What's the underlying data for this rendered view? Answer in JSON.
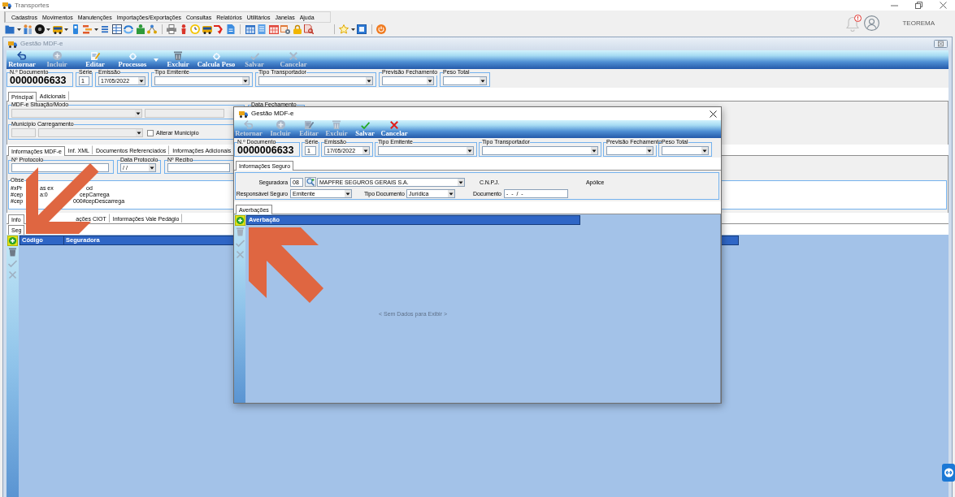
{
  "app_window": {
    "title": "Transportes",
    "user_name": "TEOREMA"
  },
  "menu": [
    "Cadastros",
    "Movimentos",
    "Manutenções",
    "Importações/Exportações",
    "Consultas",
    "Relatórios",
    "Utilitários",
    "Janelas",
    "Ajuda"
  ],
  "main_window": {
    "title": "Gestão MDF-e",
    "toolbar": [
      {
        "label": "Retornar",
        "disabled": false,
        "dropdown": false
      },
      {
        "label": "Incluir",
        "disabled": true,
        "dropdown": false
      },
      {
        "label": "Editar",
        "disabled": false,
        "dropdown": false
      },
      {
        "label": "Processos",
        "disabled": false,
        "dropdown": true
      },
      {
        "label": "Excluir",
        "disabled": false,
        "dropdown": false
      },
      {
        "label": "Calcula Peso",
        "disabled": false,
        "dropdown": false
      },
      {
        "label": "Salvar",
        "disabled": true,
        "dropdown": false
      },
      {
        "label": "Cancelar",
        "disabled": true,
        "dropdown": false
      }
    ],
    "header_fields": [
      {
        "label": "N.º Documento",
        "kind": "display",
        "value": "0000006633"
      },
      {
        "label": "Série",
        "kind": "text",
        "value": "1"
      },
      {
        "label": "Emissão",
        "kind": "select",
        "value": "17/05/2022"
      },
      {
        "label": "Tipo Emitente",
        "kind": "select"
      },
      {
        "label": "Tipo Transportador",
        "kind": "select"
      },
      {
        "label": "Previsão Fechamento",
        "kind": "select"
      },
      {
        "label": "Peso Total",
        "kind": "select"
      }
    ],
    "tabs": [
      {
        "label": "Principal",
        "selected": true
      },
      {
        "label": "Adicionais",
        "selected": false
      }
    ],
    "situation_group": {
      "label": "MDF-e Situação/Modo",
      "fields": [
        {
          "kind": "select",
          "disabled": true
        },
        {
          "kind": "text",
          "disabled": true
        }
      ]
    },
    "closing_date_group": {
      "label": "Data Fechamento"
    },
    "loading_city_group": {
      "label": "Município Carregamento",
      "fields": [
        {
          "kind": "text",
          "disabled": true
        },
        {
          "kind": "select",
          "disabled": true
        }
      ],
      "checkbox": {
        "label": "Alterar Município",
        "checked": false
      }
    },
    "detail_tabs": [
      {
        "label": "Informações MDF-e",
        "selected": true
      },
      {
        "label": "Inf. XML",
        "selected": false
      },
      {
        "label": "Documentos Referenciados",
        "selected": false
      },
      {
        "label": "Informações Adicionais",
        "selected": false
      }
    ],
    "protocol_fields": [
      {
        "label": "Nº Protocolo",
        "kind": "text"
      },
      {
        "label": "Data Protocolo",
        "kind": "select",
        "value": "/ /"
      },
      {
        "label": "Nº Recibo",
        "kind": "text"
      }
    ],
    "observations": {
      "label": "Obse",
      "lines": [
        [
          "#xPr",
          "as ex",
          "od"
        ],
        [
          "#cep",
          "a:0",
          "cepCarrega"
        ],
        [
          "#cep",
          "000#cepDescarrega"
        ]
      ]
    },
    "lower_tabs": [
      {
        "label": "Info",
        "selected": true
      },
      {
        "label": "ações CIOT",
        "selected": false
      },
      {
        "label": "Informações Vale Pedágio",
        "selected": false
      }
    ],
    "insurer_tabs": [
      {
        "label": "Seg",
        "selected": true
      }
    ],
    "grid": {
      "columns": [
        "Código",
        "Seguradora"
      ],
      "side_tools": [
        {
          "highlighted": true,
          "disabled": false
        },
        {
          "highlighted": false,
          "disabled": false
        },
        {
          "highlighted": false,
          "disabled": true
        },
        {
          "highlighted": false,
          "disabled": true
        }
      ]
    }
  },
  "dialog": {
    "title": "Gestão MDF-e",
    "toolbar": [
      {
        "label": "Retornar",
        "disabled": true,
        "dropdown": false
      },
      {
        "label": "Incluir",
        "disabled": true,
        "dropdown": false
      },
      {
        "label": "Editar",
        "disabled": true,
        "dropdown": false
      },
      {
        "label": "Excluir",
        "disabled": true,
        "dropdown": false
      },
      {
        "label": "Salvar",
        "disabled": false,
        "dropdown": false
      },
      {
        "label": "Cancelar",
        "disabled": false,
        "dropdown": false
      }
    ],
    "header_fields": [
      {
        "label": "N.º Documento",
        "kind": "display",
        "value": "0000006633"
      },
      {
        "label": "Série",
        "kind": "text",
        "value": "1"
      },
      {
        "label": "Emissão",
        "kind": "select",
        "value": "17/05/2022"
      },
      {
        "label": "Tipo Emitente",
        "kind": "select"
      },
      {
        "label": "Tipo Transportador",
        "kind": "select"
      },
      {
        "label": "Previsão Fechamento",
        "kind": "select"
      },
      {
        "label": "Peso Total",
        "kind": "select"
      }
    ],
    "tabs": [
      {
        "label": "Informações Seguro",
        "selected": true
      }
    ],
    "insurance": {
      "insurer_label": "Seguradora",
      "insurer_code": "08",
      "insurer_name": "MAPFRE SEGUROS GERAIS S.A.",
      "cnpj_label": "C.N.P.J.",
      "policy_label": "Apólice",
      "responsible_label": "Responsável Seguro",
      "responsible_value": "Emitente",
      "document_type_label": "Tipo Documento",
      "document_type_value": "Jurídica",
      "document_label": "Documento",
      "document_value": "-  -  /  -"
    },
    "endorsement_tabs": [
      {
        "label": "Averbações",
        "selected": true
      }
    ],
    "grid": {
      "columns": [
        "Averbação"
      ],
      "empty_text": "< Sem Dados para Exibir >",
      "side_tools": [
        {
          "highlighted": true,
          "disabled": false
        },
        {
          "highlighted": false,
          "disabled": true
        },
        {
          "highlighted": false,
          "disabled": true
        },
        {
          "highlighted": false,
          "disabled": true
        }
      ]
    }
  }
}
